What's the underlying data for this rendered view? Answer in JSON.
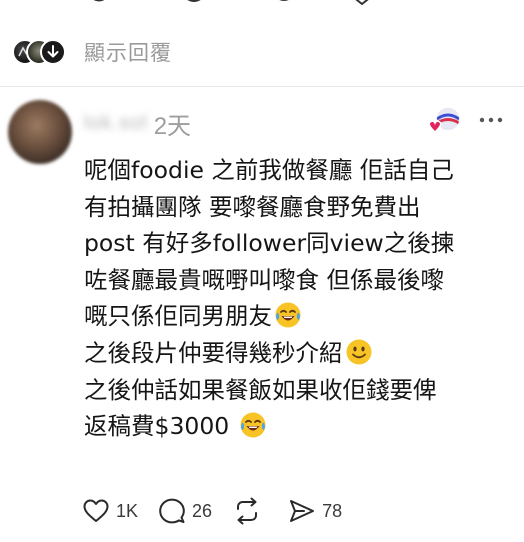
{
  "show_replies": {
    "label": "顯示回覆"
  },
  "comment": {
    "username": "lok.sol",
    "timestamp": "2天",
    "body_lines": [
      "呢個foodie 之前我做餐廳 佢話自己",
      "有拍攝團隊 要嚟餐廳食野免費出",
      "post 有好多follower同view之後揀",
      "咗餐廳最貴嘅嘢叫嚟食 但係最後嚟",
      "嘅只係佢同男朋友",
      "之後段片仲要得幾秒介紹",
      "之後仲話如果餐飯如果收佢錢要俾",
      "返稿費$3000"
    ],
    "emoji_lines": {
      "4": "laughing-tears-emoji",
      "5": "smiling-face-emoji",
      "7": "laughing-tears-emoji"
    }
  },
  "actions": {
    "like_count": "1K",
    "reply_count": "26",
    "repost_count": "",
    "share_count": "78"
  },
  "icons": {
    "like": "heart-icon",
    "reply": "speech-bubble-icon",
    "repost": "repost-arrows-icon",
    "share": "paper-plane-icon",
    "more": "more-dots-icon",
    "liked_by": "liked-by-author-avatar-icon"
  },
  "colors": {
    "muted_text": "#9a9a9a",
    "body_text": "#151515",
    "heart_red": "#e0245e",
    "emoji_yellow": "#f7c325"
  }
}
